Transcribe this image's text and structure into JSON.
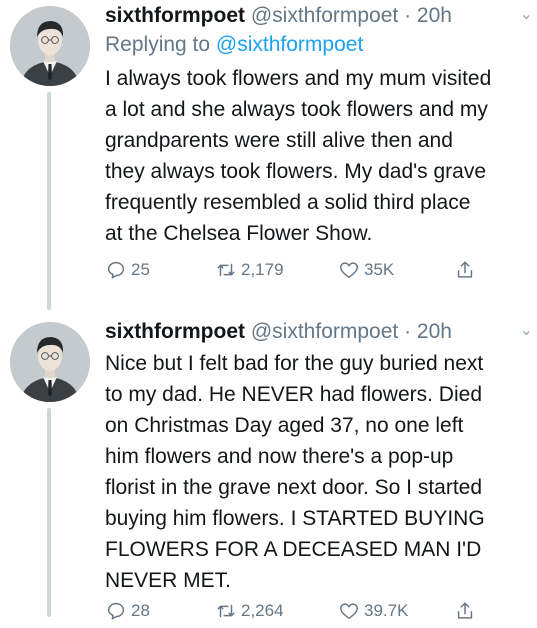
{
  "tweets": [
    {
      "display_name": "sixthformpoet",
      "handle": "@sixthformpoet",
      "time": "· 20h",
      "replying_prefix": "Replying to ",
      "replying_handle": "@sixthformpoet",
      "lines": [
        "I always took flowers and my mum visited",
        "a lot and she always took flowers and my",
        "grandparents were still alive then and",
        "they always took flowers. My dad's grave",
        "frequently resembled a solid third place",
        "at the Chelsea Flower Show."
      ],
      "replies": "25",
      "retweets": "2,179",
      "likes": "35K"
    },
    {
      "display_name": "sixthformpoet",
      "handle": "@sixthformpoet",
      "time": "· 20h",
      "lines": [
        "Nice but I felt bad for the guy buried next",
        "to my dad. He NEVER had flowers. Died",
        "on Christmas Day aged 37, no one left",
        "him flowers and now there's a pop-up",
        "florist in the grave next door. So I started",
        "buying him flowers. I STARTED BUYING",
        "FLOWERS FOR A DECEASED MAN I'D",
        "NEVER MET."
      ],
      "replies": "28",
      "retweets": "2,264",
      "likes": "39.7K"
    }
  ]
}
